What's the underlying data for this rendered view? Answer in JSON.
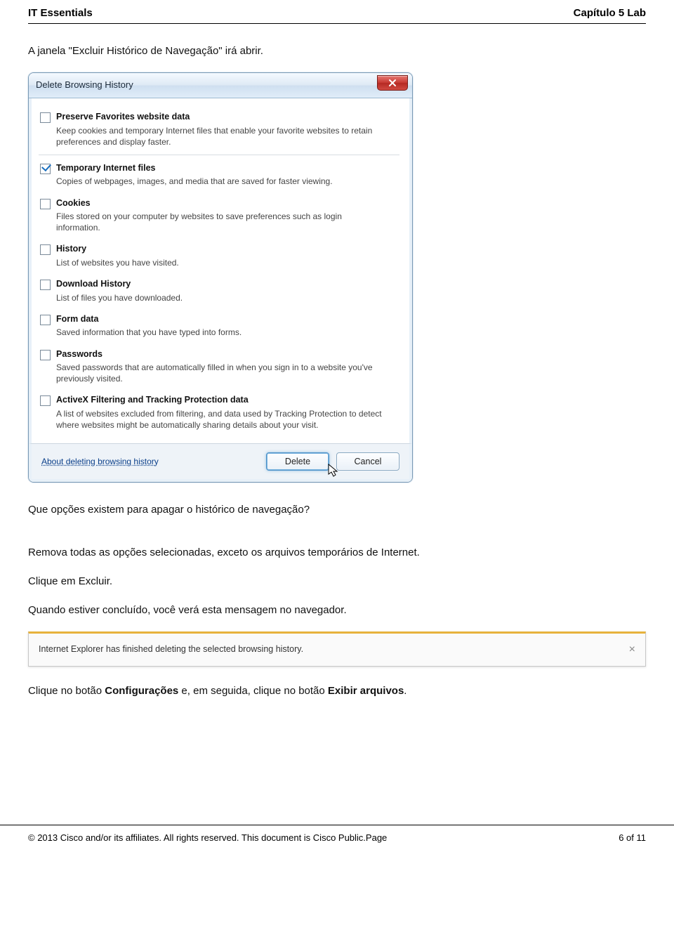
{
  "header": {
    "left": "IT Essentials",
    "right": "Capítulo 5 Lab"
  },
  "intro_text": "A janela \"Excluir Histórico de Navegação\" irá abrir.",
  "dialog": {
    "title": "Delete Browsing History",
    "options": [
      {
        "checked": false,
        "label": "Preserve Favorites website data",
        "desc": "Keep cookies and temporary Internet files that enable your favorite websites to retain preferences and display faster."
      },
      {
        "checked": true,
        "label": "Temporary Internet files",
        "desc": "Copies of webpages, images, and media that are saved for faster viewing."
      },
      {
        "checked": false,
        "label": "Cookies",
        "desc": "Files stored on your computer by websites to save preferences such as login information."
      },
      {
        "checked": false,
        "label": "History",
        "desc": "List of websites you have visited."
      },
      {
        "checked": false,
        "label": "Download History",
        "desc": "List of files you have downloaded."
      },
      {
        "checked": false,
        "label": "Form data",
        "desc": "Saved information that you have typed into forms."
      },
      {
        "checked": false,
        "label": "Passwords",
        "desc": "Saved passwords that are automatically filled in when you sign in to a website you've previously visited."
      },
      {
        "checked": false,
        "label": "ActiveX Filtering and Tracking Protection data",
        "desc": "A list of websites excluded from filtering, and data used by Tracking Protection to detect where websites might be automatically sharing details about your visit."
      }
    ],
    "about_link": "About deleting browsing history",
    "delete_btn": "Delete",
    "cancel_btn": "Cancel"
  },
  "question": "Que opções existem para apagar o histórico de navegação?",
  "instruction1": "Remova todas as opções selecionadas, exceto os arquivos temporários de Internet.",
  "instruction2": "Clique em Excluir.",
  "instruction3": "Quando estiver concluído, você verá esta mensagem no navegador.",
  "msgbar": {
    "text": "Internet Explorer has finished deleting the selected browsing history.",
    "close": "×"
  },
  "instruction4_pre": "Clique no botão ",
  "instruction4_bold1": "Configurações",
  "instruction4_mid": " e, em seguida, clique no botão ",
  "instruction4_bold2": "Exibir arquivos",
  "instruction4_end": ".",
  "footer": {
    "left": "© 2013 Cisco and/or its affiliates. All rights reserved. This document is Cisco Public.Page",
    "right": "6 of 11"
  }
}
